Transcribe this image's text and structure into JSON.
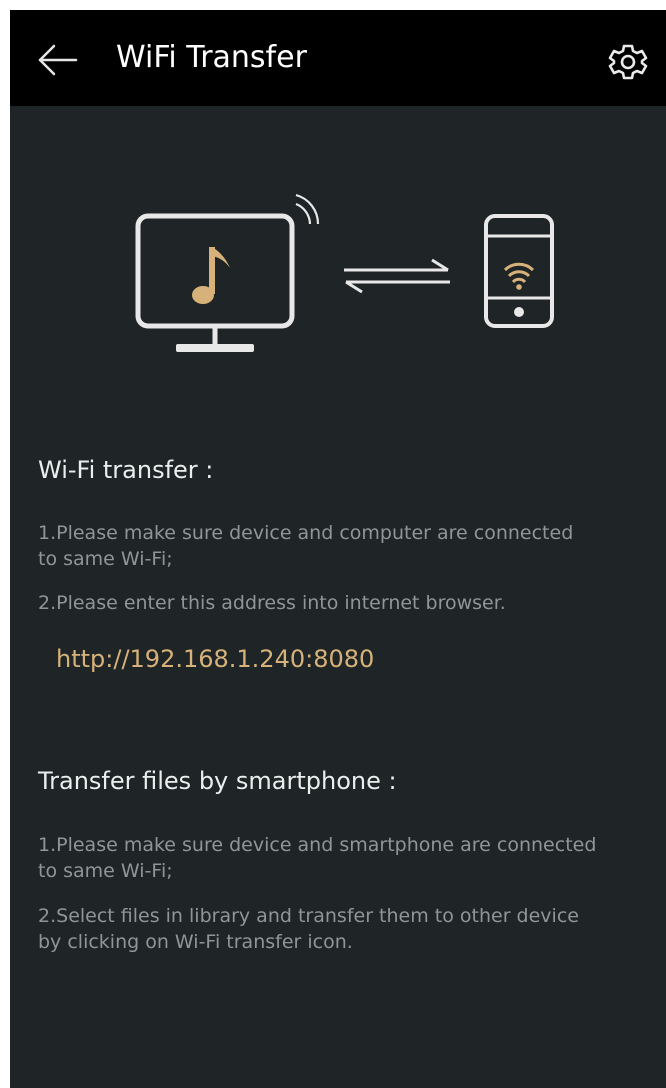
{
  "header": {
    "title": "WiFi Transfer",
    "back_icon": "arrow-left-icon",
    "settings_icon": "gear-icon"
  },
  "illustration": {
    "computer_icon": "monitor-music-icon",
    "transfer_icon": "swap-arrows-icon",
    "phone_icon": "phone-wifi-icon"
  },
  "wifi_section": {
    "title": "Wi-Fi transfer :",
    "step1_line1": "1.Please make sure device and computer are connected",
    "step1_line2": "to same Wi-Fi;",
    "step2": "2.Please enter this address into internet browser.",
    "address": "http://192.168.1.240:8080"
  },
  "phone_section": {
    "title": "Transfer files by smartphone :",
    "step1_line1": "1.Please make sure device and smartphone are connected",
    "step1_line2": "to same Wi-Fi;",
    "step2_line1": "2.Select files in library and transfer them to other device",
    "step2_line2": "by clicking on Wi-Fi transfer icon."
  },
  "colors": {
    "background": "#1f2526",
    "header": "#000000",
    "accent": "#d6b27a",
    "body_text": "#8e9697",
    "heading_text": "#eceeee"
  }
}
